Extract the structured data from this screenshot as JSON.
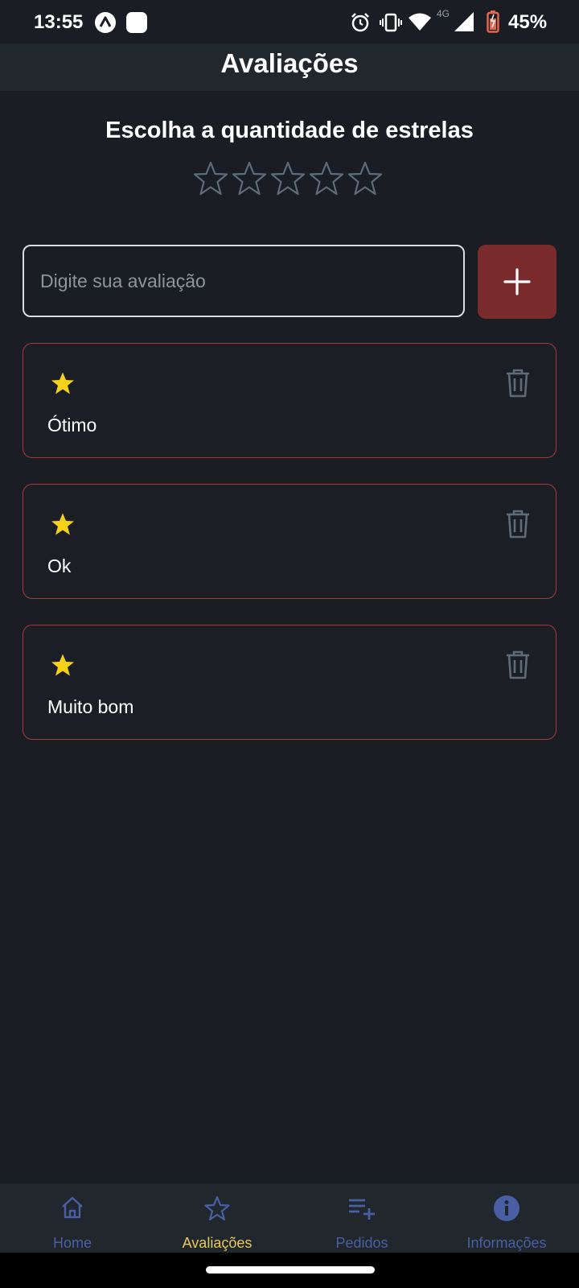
{
  "status_bar": {
    "time": "13:55",
    "network": "4G",
    "battery": "45%",
    "battery_color": "#e8644a"
  },
  "header": {
    "title": "Avaliações"
  },
  "rating_picker": {
    "heading": "Escolha a quantidade de estrelas",
    "star_count": 5,
    "selected": 0
  },
  "review_input": {
    "value": "",
    "placeholder": "Digite sua avaliação"
  },
  "add_button": {
    "icon": "plus-icon",
    "color": "#7a2c2c"
  },
  "reviews": [
    {
      "stars": 1,
      "text": "Ótimo"
    },
    {
      "stars": 1,
      "text": "Ok"
    },
    {
      "stars": 1,
      "text": "Muito bom"
    }
  ],
  "colors": {
    "background": "#1a1e24",
    "card_border": "#a33a3a",
    "star_filled": "#f5d21a",
    "active_nav": "#e8c85a",
    "inactive_nav": "#4a5fa3"
  },
  "bottom_nav": [
    {
      "label": "Home",
      "icon": "home-icon",
      "active": false
    },
    {
      "label": "Avaliações",
      "icon": "star-outline-icon",
      "active": true
    },
    {
      "label": "Pedidos",
      "icon": "playlist-add-icon",
      "active": false
    },
    {
      "label": "Informações",
      "icon": "info-icon",
      "active": false
    }
  ]
}
